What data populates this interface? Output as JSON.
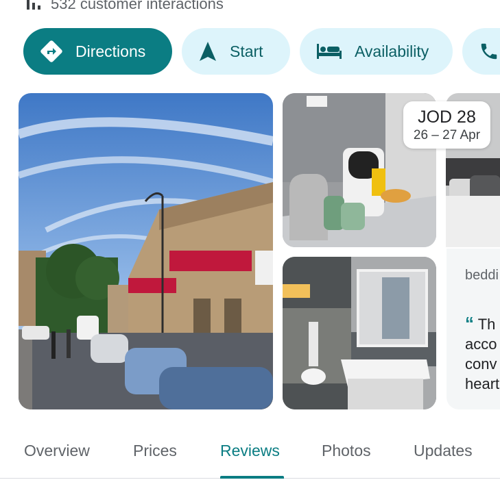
{
  "summary": {
    "interactions_text": "532 customer interactions",
    "icon": "bar-chart-icon"
  },
  "actions": [
    {
      "label": "Directions",
      "icon": "directions-icon",
      "style": "primary"
    },
    {
      "label": "Start",
      "icon": "navigation-arrow-icon",
      "style": "secondary"
    },
    {
      "label": "Availability",
      "icon": "bed-icon",
      "style": "secondary"
    },
    {
      "label": "",
      "icon": "phone-icon",
      "style": "secondary"
    }
  ],
  "price_badge": {
    "amount": "JOD 28",
    "dates": "26 – 27 Apr"
  },
  "review_card": {
    "topic": "beddi",
    "quote_lines": [
      "Th",
      "acco",
      "conv",
      "heart"
    ]
  },
  "tabs": [
    {
      "label": "Overview",
      "active": false
    },
    {
      "label": "Prices",
      "active": false
    },
    {
      "label": "Reviews",
      "active": true
    },
    {
      "label": "Photos",
      "active": false
    },
    {
      "label": "Updates",
      "active": false
    }
  ],
  "colors": {
    "accent": "#0b7d83",
    "chip_secondary_bg": "#ddf4fb",
    "muted_text": "#5f6368"
  }
}
